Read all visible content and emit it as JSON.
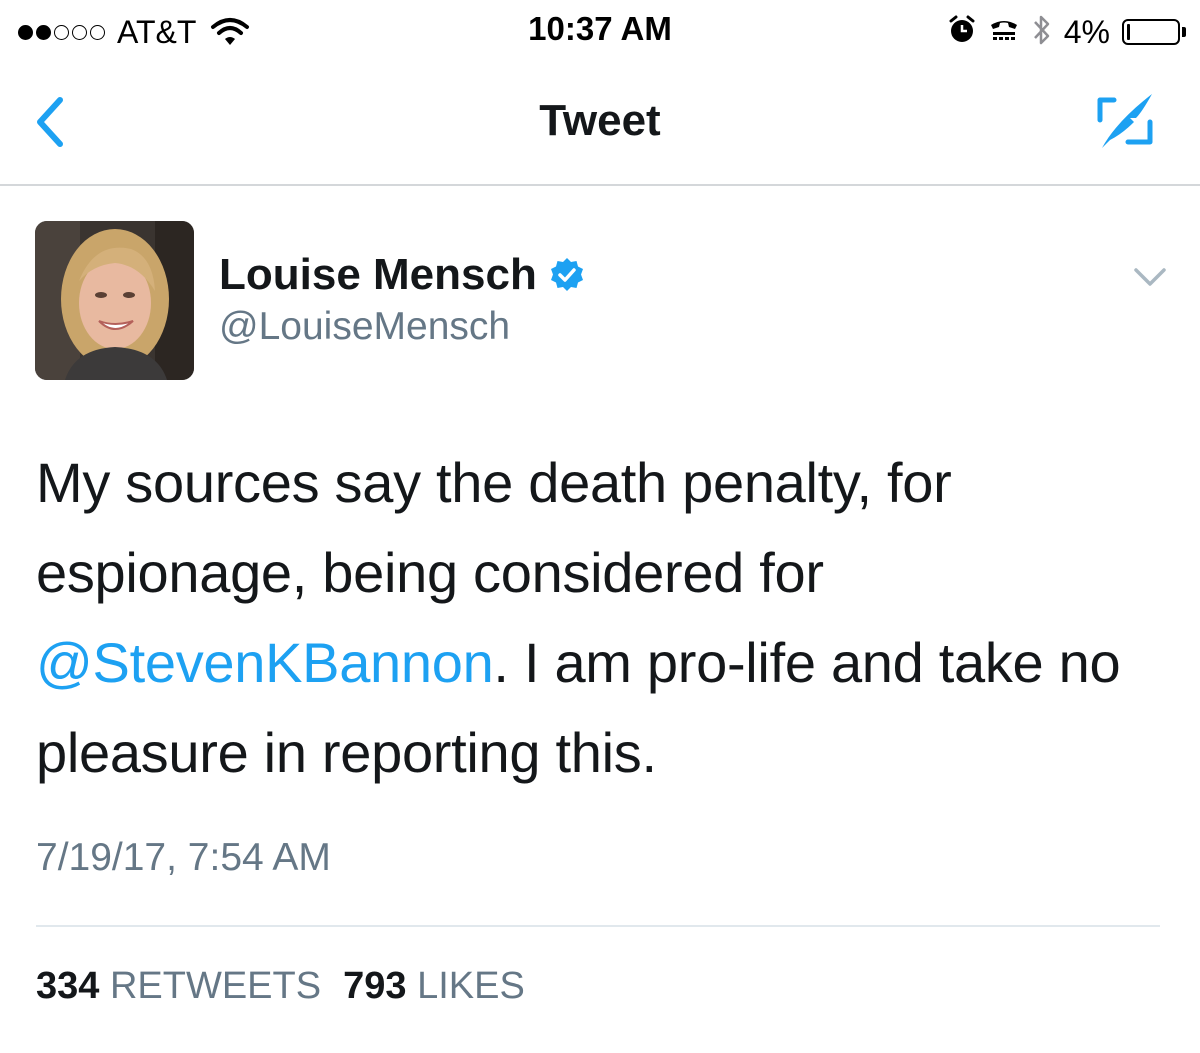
{
  "status_bar": {
    "carrier": "AT&T",
    "signal_bars_filled": 2,
    "signal_bars_total": 5,
    "time": "10:37 AM",
    "battery_percent": "4%",
    "battery_level": 0.04
  },
  "nav": {
    "title": "Tweet",
    "accent_color": "#1da1f2"
  },
  "tweet": {
    "display_name": "Louise Mensch",
    "verified": true,
    "handle": "@LouiseMensch",
    "text_before_mention": "My sources say the death penalty, for espionage, being considered for ",
    "mention": "@StevenKBannon",
    "text_after_mention": ". I am pro-life and take no pleasure in reporting this.",
    "timestamp": "7/19/17, 7:54 AM",
    "retweets_count": "334",
    "retweets_label": "RETWEETS",
    "likes_count": "793",
    "likes_label": "LIKES"
  },
  "colors": {
    "text_primary": "#14171a",
    "text_secondary": "#657786",
    "link": "#1da1f2",
    "divider": "#e1e8ed"
  }
}
